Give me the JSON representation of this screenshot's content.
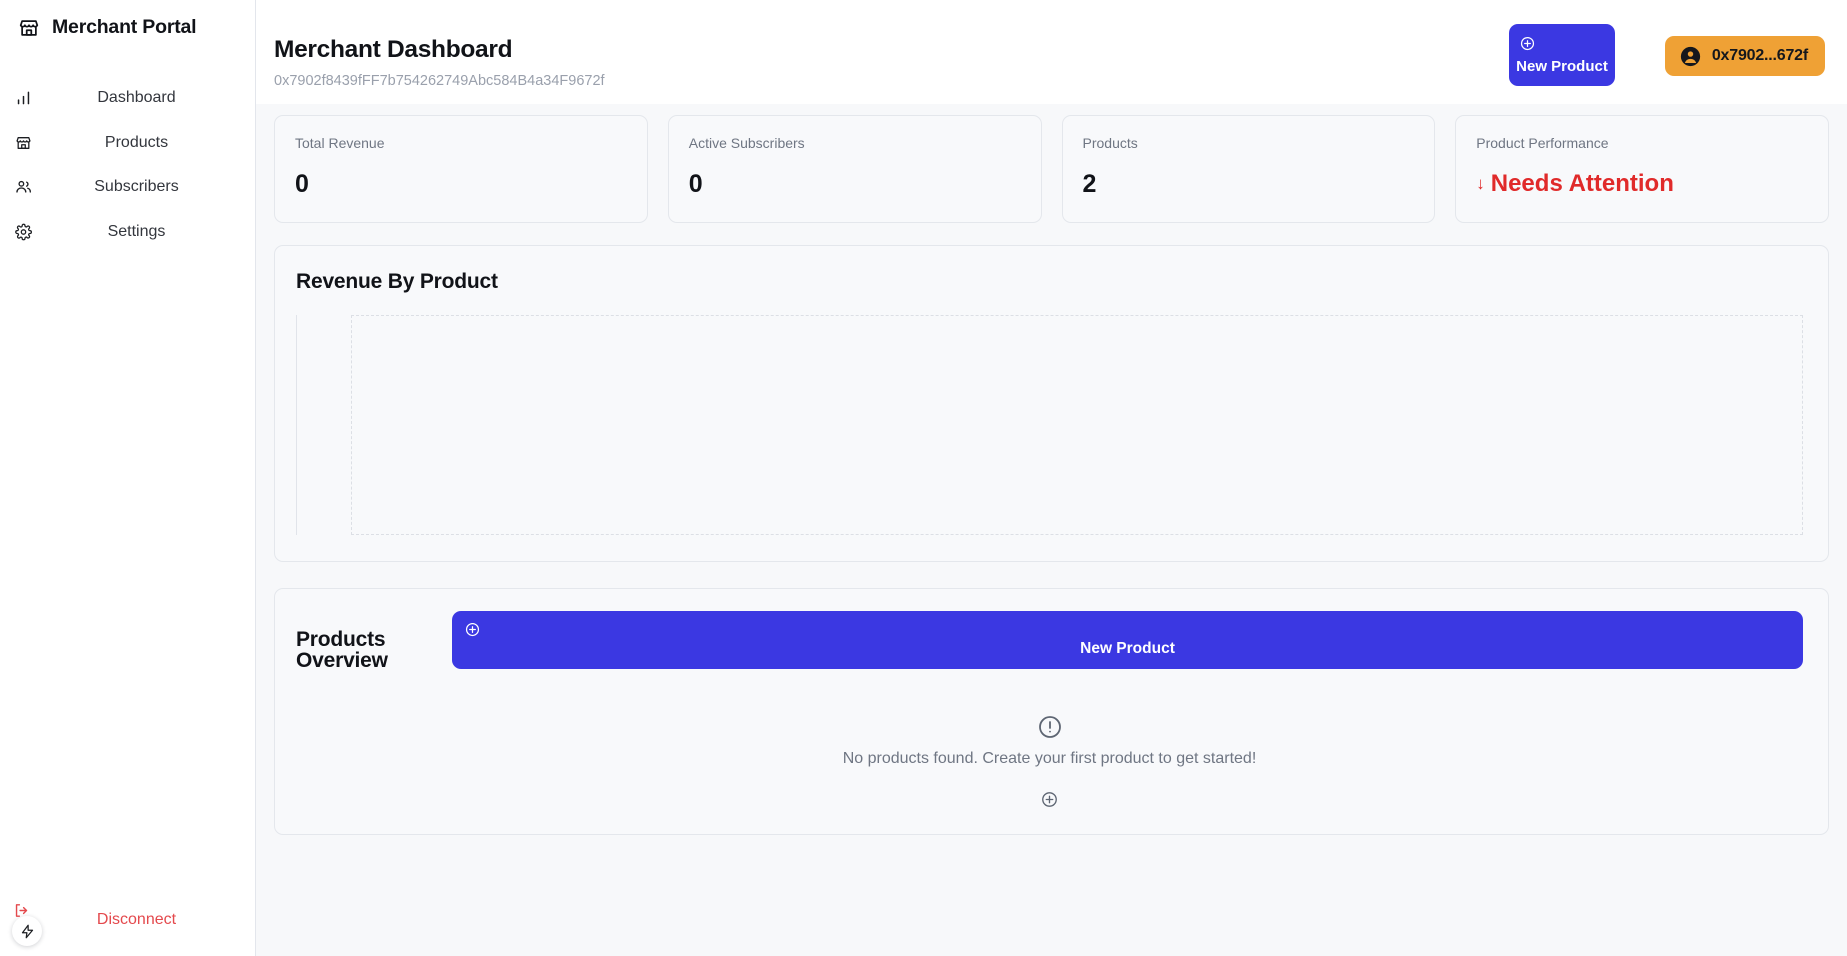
{
  "sidebar": {
    "brand": {
      "title": "Merchant Portal",
      "icon": "store-icon"
    },
    "items": [
      {
        "label": "Dashboard",
        "icon": "bar-chart-icon"
      },
      {
        "label": "Products",
        "icon": "store-icon"
      },
      {
        "label": "Subscribers",
        "icon": "users-icon"
      },
      {
        "label": "Settings",
        "icon": "gear-icon"
      }
    ],
    "disconnect": {
      "label": "Disconnect",
      "icon": "logout-icon",
      "badge_icon": "lightning-bolt-icon",
      "color": "#e4494d"
    }
  },
  "header": {
    "title": "Merchant Dashboard",
    "address": "0x7902f8439fFF7b754262749Abc584B4a34F9672f",
    "new_product_button": {
      "label": "New Product",
      "icon": "plus-circle-icon",
      "color": "#3b38e2"
    },
    "wallet_button": {
      "label": "0x7902...672f",
      "icon": "user-circle-icon",
      "color": "#efa135"
    }
  },
  "stats": [
    {
      "label": "Total Revenue",
      "value": "0"
    },
    {
      "label": "Active Subscribers",
      "value": "0"
    },
    {
      "label": "Products",
      "value": "2"
    },
    {
      "label": "Product Performance",
      "value": "Needs Attention",
      "arrow": "↓",
      "status_color": "#e02a2a",
      "is_alert": true
    }
  ],
  "chart_panel": {
    "title": "Revenue By Product"
  },
  "chart_data": {
    "type": "bar",
    "title": "Revenue By Product",
    "categories": [],
    "values": [],
    "series": [],
    "xlabel": "",
    "ylabel": "",
    "grid": false,
    "legend": "none",
    "empty": true,
    "empty_reason": "No revenue data — chart plot area is an empty dashed placeholder"
  },
  "products_panel": {
    "title": "Products Overview",
    "new_product_button": {
      "label": "New Product",
      "icon": "plus-circle-icon",
      "color": "#3b38e2"
    },
    "empty_state": {
      "icon": "alert-circle-icon",
      "message": "No products found. Create your first product to get started!",
      "bottom_icon": "plus-circle-icon"
    }
  }
}
